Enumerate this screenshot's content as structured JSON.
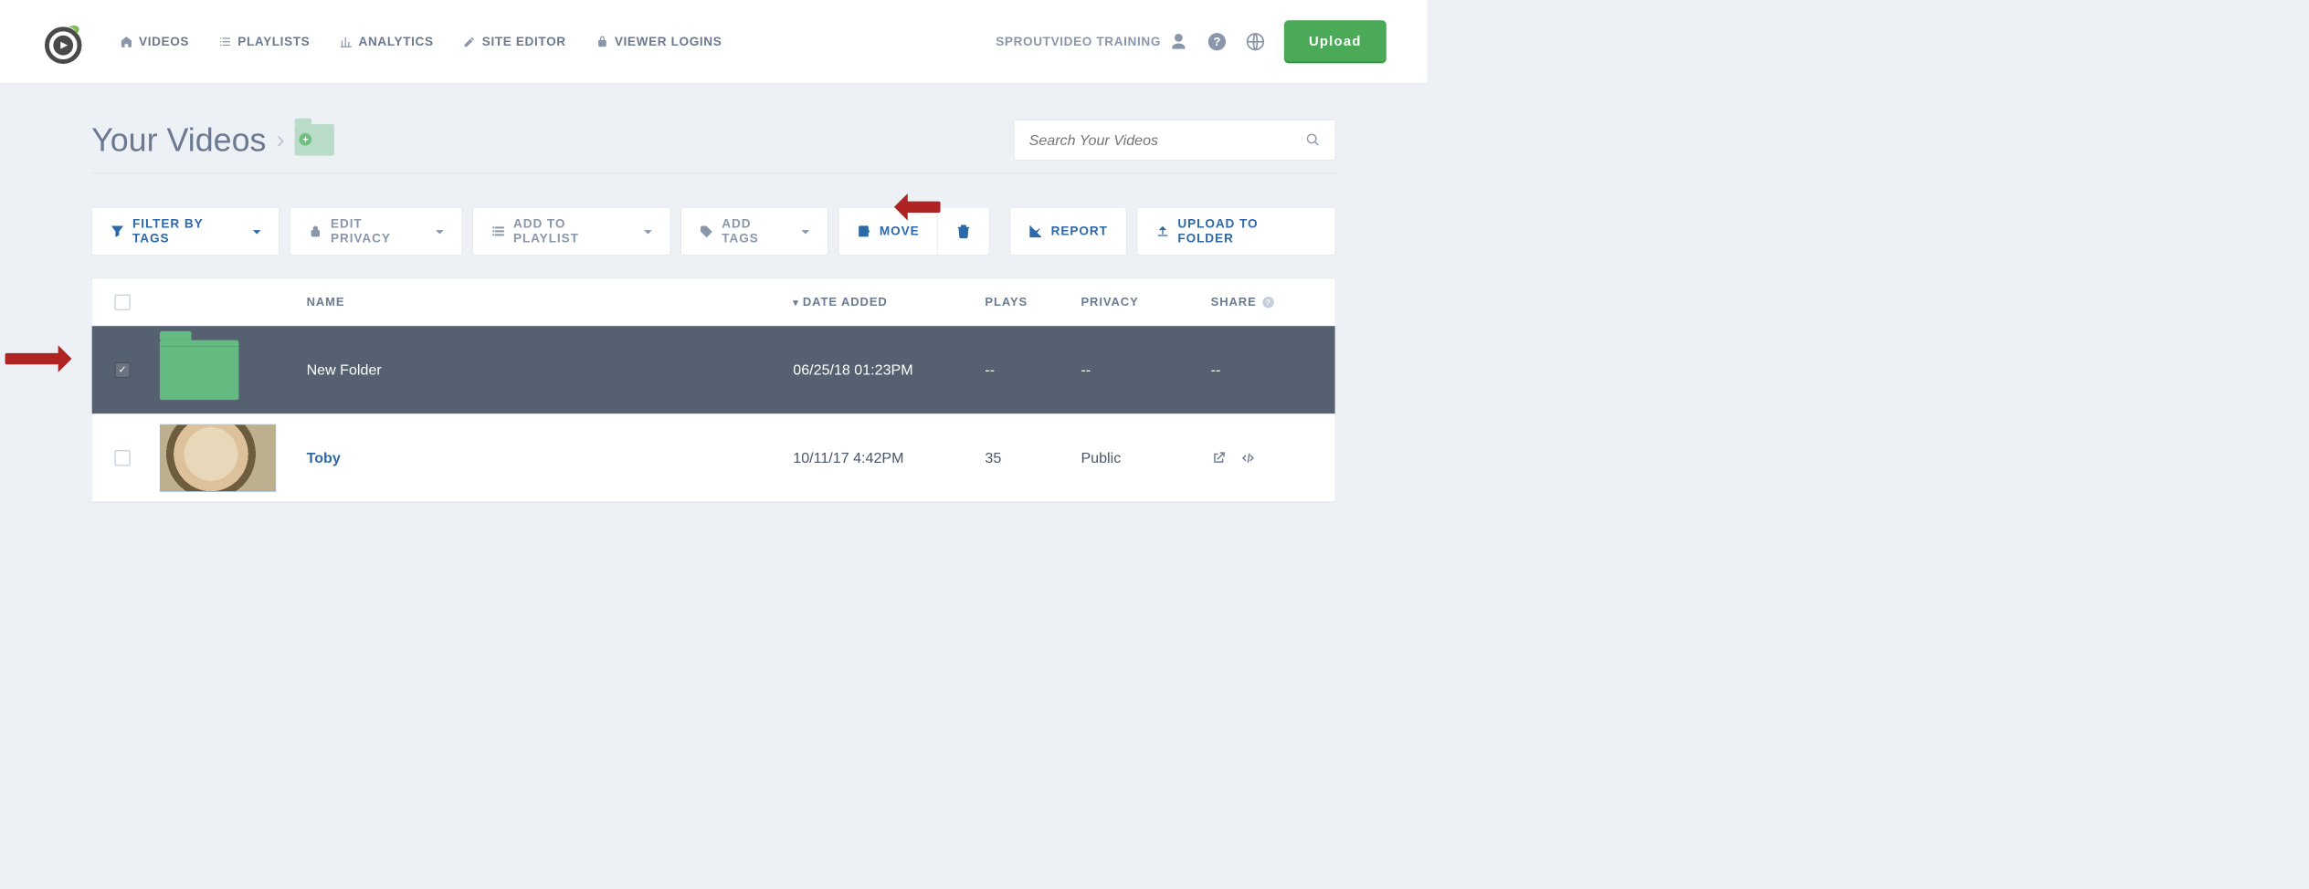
{
  "nav": {
    "videos": "Videos",
    "playlists": "Playlists",
    "analytics": "Analytics",
    "site_editor": "Site Editor",
    "viewer_logins": "Viewer Logins"
  },
  "account": {
    "label": "SproutVideo Training"
  },
  "upload": "Upload",
  "page_title": "Your Videos",
  "search": {
    "placeholder": "Search Your Videos"
  },
  "toolbar": {
    "filter": "Filter by Tags",
    "edit_privacy": "Edit Privacy",
    "add_playlist": "Add to Playlist",
    "add_tags": "Add Tags",
    "move": "Move",
    "report": "Report",
    "upload_folder": "Upload to Folder"
  },
  "columns": {
    "name": "Name",
    "date_added": "Date Added",
    "plays": "Plays",
    "privacy": "Privacy",
    "share": "Share"
  },
  "rows": [
    {
      "type": "folder",
      "selected": true,
      "name": "New Folder",
      "date": "06/25/18 01:23PM",
      "plays": "--",
      "privacy": "--",
      "share": "--"
    },
    {
      "type": "video",
      "selected": false,
      "name": "Toby",
      "date": "10/11/17 4:42PM",
      "plays": "35",
      "privacy": "Public",
      "share": "icons"
    }
  ]
}
